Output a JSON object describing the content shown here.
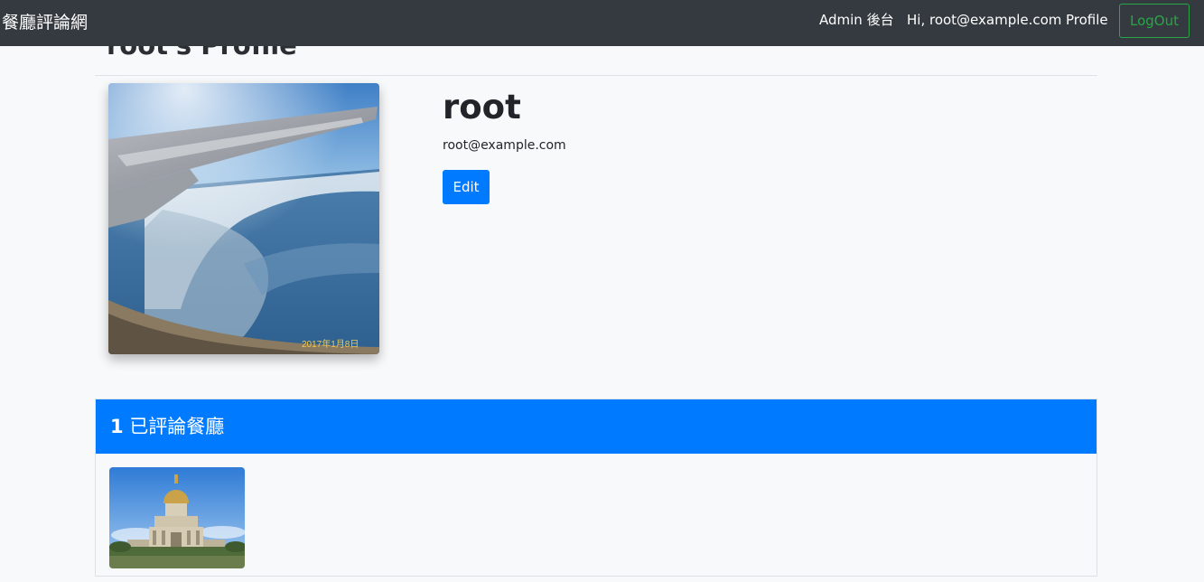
{
  "navbar": {
    "brand": "餐廳評論網",
    "links": [
      {
        "label": "Admin 後台"
      },
      {
        "label": "Hi, root@example.com"
      },
      {
        "label": "Profile"
      }
    ],
    "logout_label": "LogOut"
  },
  "page": {
    "title": "root's Profile"
  },
  "profile": {
    "name": "root",
    "email": "root@example.com",
    "edit_label": "Edit",
    "photo_date_stamp": "2017年1月8日"
  },
  "reviewed": {
    "count": "1",
    "label": "已評論餐廳"
  },
  "colors": {
    "navbar_bg": "#343a40",
    "primary": "#007bff",
    "success": "#28a745",
    "page_bg": "#f8f9fa"
  }
}
